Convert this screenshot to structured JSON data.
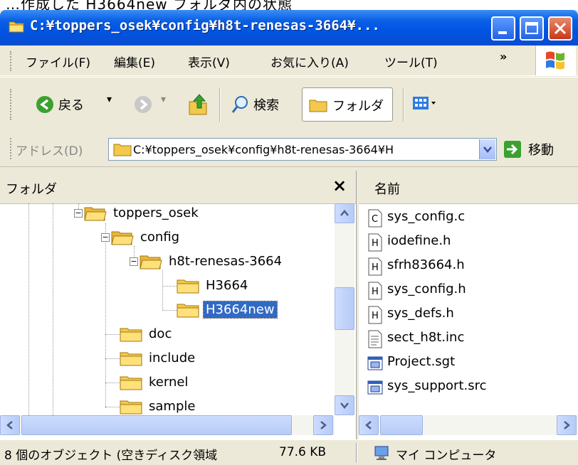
{
  "window": {
    "title": "C:¥toppers_osek¥config¥h8t-renesas-3664¥...",
    "top_strip_text": "…作成した H3664new フォルダ内の状態"
  },
  "menu": {
    "items": [
      "ファイル(F)",
      "編集(E)",
      "表示(V)",
      "お気に入り(A)",
      "ツール(T)"
    ],
    "more": "»"
  },
  "toolbar": {
    "back_label": "戻る",
    "search_label": "検索",
    "folders_label": "フォルダ"
  },
  "address": {
    "label": "アドレス(D)",
    "value": "C:¥toppers_osek¥config¥h8t-renesas-3664¥H",
    "go_label": "移動"
  },
  "folder_pane": {
    "title": "フォルダ",
    "close": "×",
    "tree": [
      {
        "label": "toppers_osek",
        "level": 0,
        "expanded": true
      },
      {
        "label": "config",
        "level": 1,
        "expanded": true
      },
      {
        "label": "h8t-renesas-3664",
        "level": 2,
        "expanded": true
      },
      {
        "label": "H3664",
        "level": 3
      },
      {
        "label": "H3664new",
        "level": 3,
        "selected": true
      },
      {
        "label": "doc",
        "level": 1
      },
      {
        "label": "include",
        "level": 1
      },
      {
        "label": "kernel",
        "level": 1
      },
      {
        "label": "sample",
        "level": 1
      }
    ]
  },
  "file_pane": {
    "column_name": "名前",
    "files": [
      {
        "name": "sys_config.c",
        "icon": "c-file-icon"
      },
      {
        "name": "iodefine.h",
        "icon": "h-file-icon"
      },
      {
        "name": "sfrh83664.h",
        "icon": "h-file-icon"
      },
      {
        "name": "sys_config.h",
        "icon": "h-file-icon"
      },
      {
        "name": "sys_defs.h",
        "icon": "h-file-icon"
      },
      {
        "name": "sect_h8t.inc",
        "icon": "text-file-icon"
      },
      {
        "name": "Project.sgt",
        "icon": "project-file-icon"
      },
      {
        "name": "sys_support.src",
        "icon": "project-file-icon"
      }
    ]
  },
  "status": {
    "objects": "8 個のオブジェクト (空きディスク領域",
    "size": "77.6 KB",
    "location": "マイ コンピュータ"
  },
  "colors": {
    "titlebar": "#0054e3",
    "selection": "#316ac5",
    "folder": "#f2c94c",
    "chrome": "#ece9d8"
  }
}
